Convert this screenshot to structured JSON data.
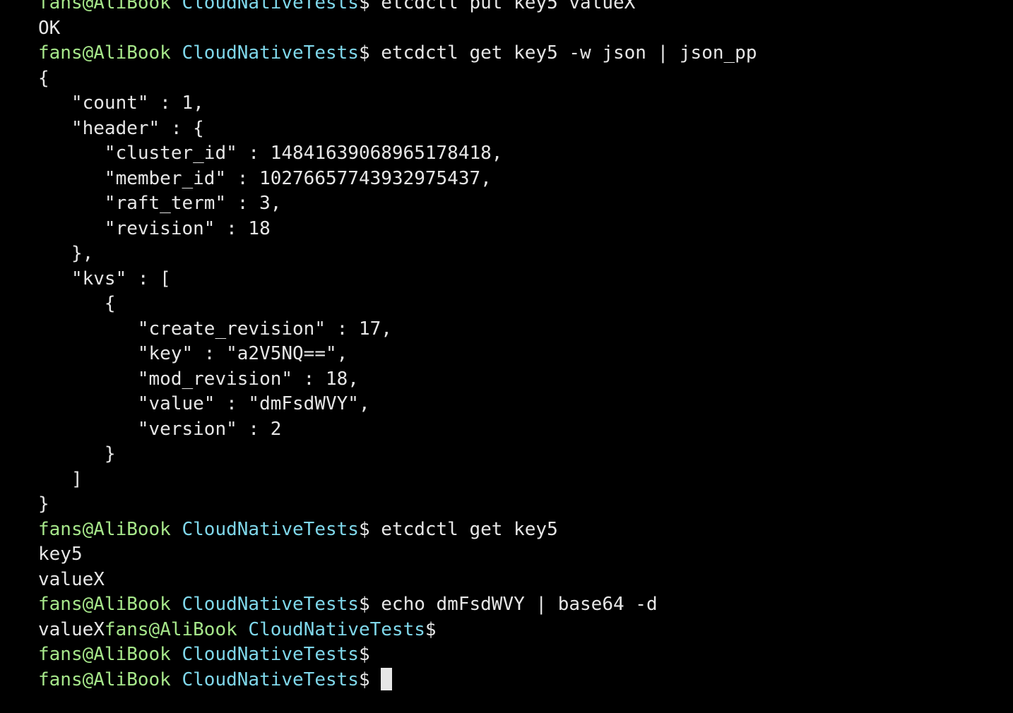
{
  "colors": {
    "background": "#000000",
    "foreground": "#e6e6e6",
    "prompt_user": "#a6e68a",
    "prompt_dir": "#7fd7ea"
  },
  "prompt": {
    "user": "fans@AliBook",
    "dir": "CloudNativeTests",
    "symbol": "$"
  },
  "lines": [
    {
      "type": "prompt",
      "command": " etcdctl put key5 valueX"
    },
    {
      "type": "output",
      "text": "OK"
    },
    {
      "type": "prompt",
      "command": " etcdctl get key5 -w json | json_pp"
    },
    {
      "type": "output",
      "text": "{"
    },
    {
      "type": "output",
      "text": "   \"count\" : 1,"
    },
    {
      "type": "output",
      "text": "   \"header\" : {"
    },
    {
      "type": "output",
      "text": "      \"cluster_id\" : 14841639068965178418,"
    },
    {
      "type": "output",
      "text": "      \"member_id\" : 10276657743932975437,"
    },
    {
      "type": "output",
      "text": "      \"raft_term\" : 3,"
    },
    {
      "type": "output",
      "text": "      \"revision\" : 18"
    },
    {
      "type": "output",
      "text": "   },"
    },
    {
      "type": "output",
      "text": "   \"kvs\" : ["
    },
    {
      "type": "output",
      "text": "      {"
    },
    {
      "type": "output",
      "text": "         \"create_revision\" : 17,"
    },
    {
      "type": "output",
      "text": "         \"key\" : \"a2V5NQ==\","
    },
    {
      "type": "output",
      "text": "         \"mod_revision\" : 18,"
    },
    {
      "type": "output",
      "text": "         \"value\" : \"dmFsdWVY\","
    },
    {
      "type": "output",
      "text": "         \"version\" : 2"
    },
    {
      "type": "output",
      "text": "      }"
    },
    {
      "type": "output",
      "text": "   ]"
    },
    {
      "type": "output",
      "text": "}"
    },
    {
      "type": "prompt",
      "command": " etcdctl get key5"
    },
    {
      "type": "output",
      "text": "key5"
    },
    {
      "type": "output",
      "text": "valueX"
    },
    {
      "type": "prompt",
      "command": " echo dmFsdWVY | base64 -d"
    },
    {
      "type": "output-prompt",
      "text": "valueX"
    },
    {
      "type": "prompt",
      "command": ""
    },
    {
      "type": "prompt",
      "command": " ",
      "cursor": true
    }
  ]
}
